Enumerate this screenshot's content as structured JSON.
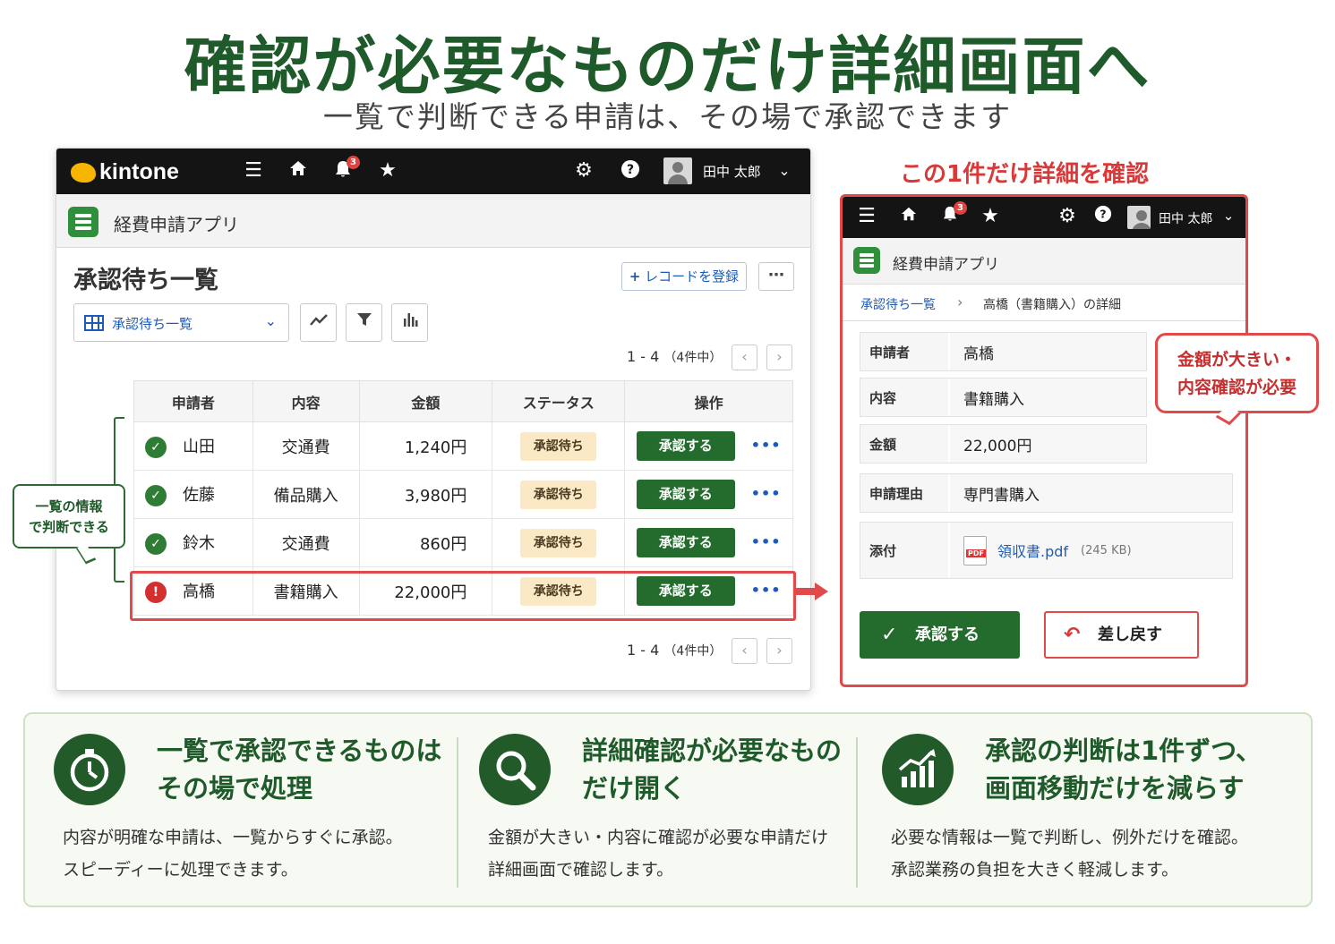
{
  "headline": "確認が必要なものだけ詳細画面へ",
  "subhead": "一覧で判断できる申請は、その場で承認できます",
  "topbar": {
    "logo": "kintone",
    "notification_count": "3",
    "user": "田中 太郎"
  },
  "app_name": "経費申請アプリ",
  "list_view": {
    "title": "承認待ち一覧",
    "add_record_button": "レコードを登録",
    "view_selector": "承認待ち一覧",
    "pager_range": "1 - 4",
    "pager_total": "（4件中）",
    "columns": [
      "申請者",
      "内容",
      "金額",
      "ステータス",
      "操作"
    ],
    "rows": [
      {
        "applicant": "山田",
        "content": "交通費",
        "amount": "1,240円",
        "status": "承認待ち",
        "action": "承認する",
        "state": "ok"
      },
      {
        "applicant": "佐藤",
        "content": "備品購入",
        "amount": "3,980円",
        "status": "承認待ち",
        "action": "承認する",
        "state": "ok"
      },
      {
        "applicant": "鈴木",
        "content": "交通費",
        "amount": "860円",
        "status": "承認待ち",
        "action": "承認する",
        "state": "ok"
      },
      {
        "applicant": "高橋",
        "content": "書籍購入",
        "amount": "22,000円",
        "status": "承認待ち",
        "action": "承認する",
        "state": "alert"
      }
    ]
  },
  "left_callout": {
    "line1": "一覧の情報",
    "line2": "で判断できる"
  },
  "detail": {
    "caption": "この1件だけ詳細を確認",
    "breadcrumb_parent": "承認待ち一覧",
    "breadcrumb_current": "高橋（書籍購入）の詳細",
    "fields": [
      {
        "label": "申請者",
        "value": "高橋"
      },
      {
        "label": "内容",
        "value": "書籍購入"
      },
      {
        "label": "金額",
        "value": "22,000円"
      },
      {
        "label": "申請理由",
        "value": "専門書購入"
      }
    ],
    "attachment_label": "添付",
    "attachment_file": "領収書.pdf",
    "attachment_size": "(245 KB)",
    "approve_button": "承認する",
    "return_button": "差し戻す"
  },
  "right_callout": {
    "line1": "金額が大きい・",
    "line2": "内容確認が必要"
  },
  "features": [
    {
      "icon": "stopwatch-icon",
      "title_line1": "一覧で承認できるものは",
      "title_line2": "その場で処理",
      "desc_line1": "内容が明確な申請は、一覧からすぐに承認。",
      "desc_line2": "スピーディーに処理できます。"
    },
    {
      "icon": "search-icon",
      "title_line1": "詳細確認が必要なもの",
      "title_line2": "だけ開く",
      "desc_line1": "金額が大きい・内容に確認が必要な申請だけ",
      "desc_line2": "詳細画面で確認します。"
    },
    {
      "icon": "growth-chart-icon",
      "title_line1": "承認の判断は1件ずつ、",
      "title_line2": "画面移動だけを減らす",
      "desc_line1": "必要な情報は一覧で判断し、例外だけを確認。",
      "desc_line2": "承認業務の負担を大きく軽減します。"
    }
  ],
  "colors": {
    "brand_green": "#1f5a2a",
    "approve_green": "#246b2e",
    "alert_red": "#e04a4a",
    "link_blue": "#1e5bb8",
    "status_bg": "#fbe8c4"
  }
}
